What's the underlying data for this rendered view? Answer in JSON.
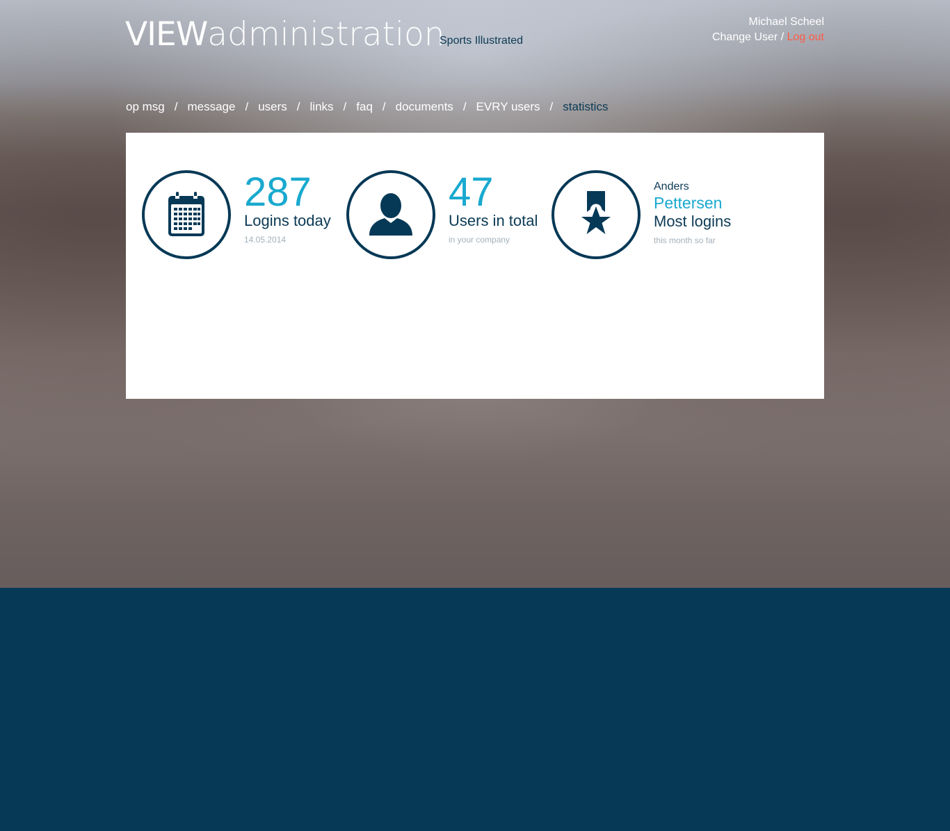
{
  "header": {
    "logo_bold": "VIEW",
    "logo_light": "administration",
    "company": "Sports Illustrated",
    "user_name": "Michael Scheel",
    "change_user": "Change User",
    "separator": "/",
    "logout": "Log out",
    "logout_color": "#ff5b48"
  },
  "nav": {
    "items": [
      {
        "label": "op msg"
      },
      {
        "label": "message"
      },
      {
        "label": "users"
      },
      {
        "label": "links"
      },
      {
        "label": "faq"
      },
      {
        "label": "documents"
      },
      {
        "label": "EVRY users"
      },
      {
        "label": "statistics",
        "active": true
      }
    ],
    "separator": "/"
  },
  "stats": {
    "logins": {
      "icon": "calendar-icon",
      "value": "287",
      "label": "Logins today",
      "sub": "14.05.2014"
    },
    "users": {
      "icon": "user-icon",
      "value": "47",
      "label": "Users in total",
      "sub": "in your company"
    },
    "top_user": {
      "icon": "award-ribbon-icon",
      "first_name": "Anders",
      "last_name": "Pettersen",
      "label": "Most logins",
      "sub": "this month so far"
    }
  },
  "colors": {
    "accent": "#19a9cf",
    "navy": "#063956",
    "footer": "#063956"
  }
}
